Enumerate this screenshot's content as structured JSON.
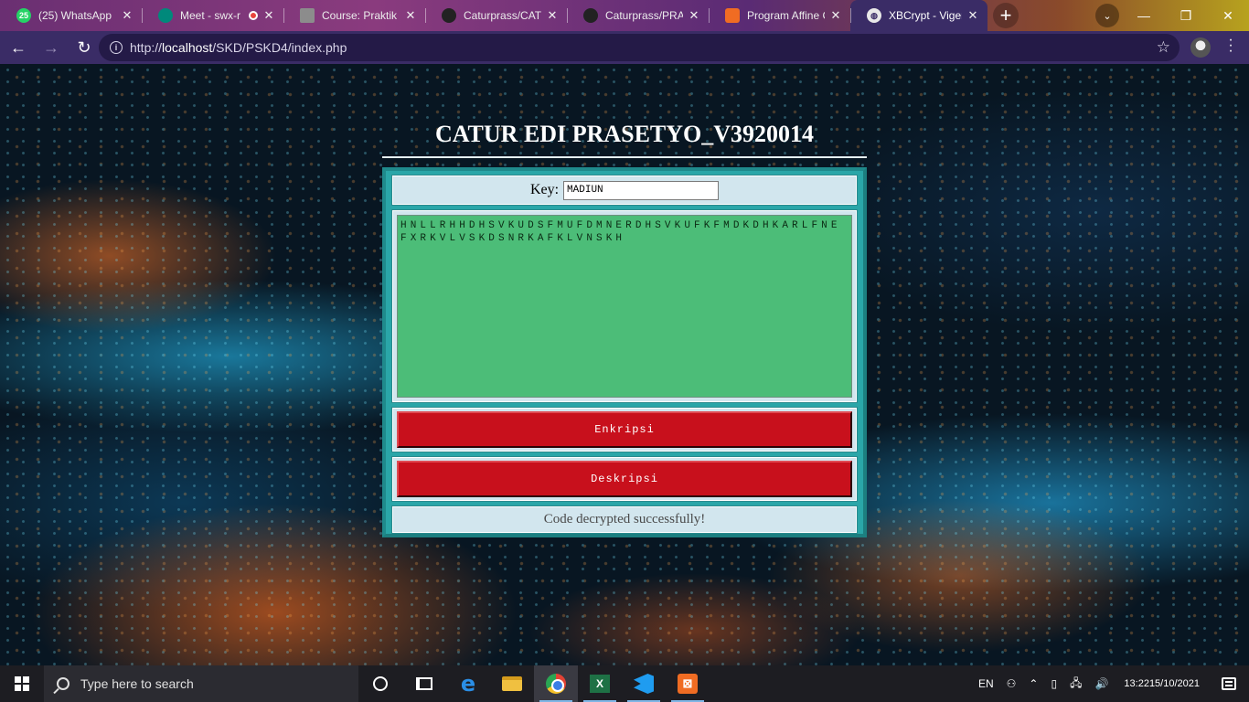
{
  "browser": {
    "tabs": [
      {
        "title": "(25) WhatsApp",
        "badge": "25",
        "color": "#25d366",
        "icon": "whatsapp-icon"
      },
      {
        "title": "Meet - swx-r",
        "color": "#00897b",
        "icon": "meet-icon",
        "recording": true
      },
      {
        "title": "Course: Praktik S",
        "color": "#8c8c8c",
        "icon": "course-icon"
      },
      {
        "title": "Caturprass/CATU",
        "color": "#222222",
        "icon": "github-icon"
      },
      {
        "title": "Caturprass/PRAK",
        "color": "#222222",
        "icon": "github-icon"
      },
      {
        "title": "Program Affine C",
        "color": "#f06c23",
        "icon": "xampp-icon"
      },
      {
        "title": "XBCrypt - Vigene",
        "color": "#4a4a4a",
        "icon": "globe-icon",
        "active": true
      }
    ],
    "url_prefix": "http://",
    "url_host": "localhost",
    "url_path": "/SKD/PSKD4/index.php"
  },
  "app": {
    "title": "CATUR EDI PRASETYO_V3920014",
    "key_label": "Key:",
    "key_value": "MADIUN",
    "text_value": "HNLLRHHDHSVKUDSFMUFDMNERDHSVKUFKFMDKDHKARLFNEFXRKVLVSKDSNRKAFKLVNSKH",
    "encrypt_label": "Enkripsi",
    "decrypt_label": "Deskripsi",
    "status_message": "Code decrypted successfully!",
    "colors": {
      "panel": "#2aa6a8",
      "textarea": "#4cbd78",
      "button": "#c8101c"
    }
  },
  "taskbar": {
    "search_placeholder": "Type here to search",
    "language": "EN",
    "time": "13:22",
    "date": "15/10/2021"
  }
}
